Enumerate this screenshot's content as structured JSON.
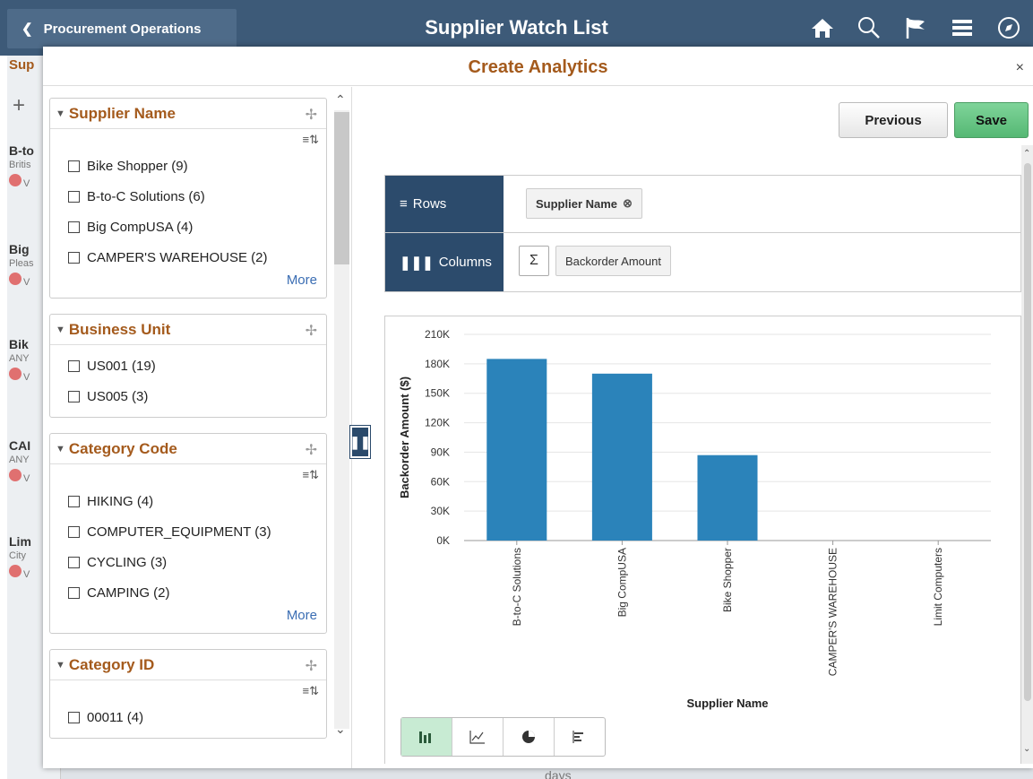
{
  "banner": {
    "back_label": "Procurement Operations",
    "title": "Supplier Watch List",
    "icons": [
      "home-icon",
      "search-icon",
      "flag-icon",
      "menu-icon",
      "compass-icon"
    ]
  },
  "background": {
    "tab_label": "Sup",
    "items": [
      {
        "name": "B-to",
        "sub": "Britis"
      },
      {
        "name": "Big",
        "sub": "Pleas"
      },
      {
        "name": "Bik",
        "sub": "ANY"
      },
      {
        "name": "CAI",
        "sub": "ANY"
      },
      {
        "name": "Lim",
        "sub": "City"
      }
    ],
    "status_prefix": "V",
    "bottom_text": "days"
  },
  "modal": {
    "title": "Create Analytics",
    "close": "×"
  },
  "facets": [
    {
      "title": "Supplier Name",
      "sortable": true,
      "options": [
        "Bike Shopper (9)",
        "B-to-C Solutions (6)",
        "Big CompUSA (4)",
        "CAMPER'S WAREHOUSE (2)"
      ],
      "more": "More"
    },
    {
      "title": "Business Unit",
      "sortable": false,
      "options": [
        "US001 (19)",
        "US005 (3)"
      ],
      "more": ""
    },
    {
      "title": "Category Code",
      "sortable": true,
      "options": [
        "HIKING (4)",
        "COMPUTER_EQUIPMENT (3)",
        "CYCLING (3)",
        "CAMPING (2)"
      ],
      "more": "More"
    },
    {
      "title": "Category ID",
      "sortable": true,
      "options": [
        "00011 (4)"
      ],
      "more": ""
    }
  ],
  "actions": {
    "previous": "Previous",
    "save": "Save"
  },
  "layout": {
    "rows_label": "Rows",
    "rows_chip": "Supplier Name",
    "columns_label": "Columns",
    "sigma": "Σ",
    "columns_chip": "Backorder Amount"
  },
  "chart_data": {
    "type": "bar",
    "categories": [
      "B-to-C Solutions",
      "Big CompUSA",
      "Bike Shopper",
      "CAMPER'S WAREHOUSE",
      "Limit Computers"
    ],
    "values": [
      185000,
      170000,
      87000,
      0,
      0
    ],
    "xlabel": "Supplier Name",
    "ylabel": "Backorder Amount ($)",
    "ylim": [
      0,
      210000
    ],
    "yticks": [
      "0K",
      "30K",
      "60K",
      "90K",
      "120K",
      "150K",
      "180K",
      "210K"
    ],
    "grid": true,
    "color": "#2b83ba"
  },
  "chart_toolbar": [
    "bar-chart-icon",
    "line-chart-icon",
    "pie-chart-icon",
    "horizontal-bar-icon"
  ]
}
